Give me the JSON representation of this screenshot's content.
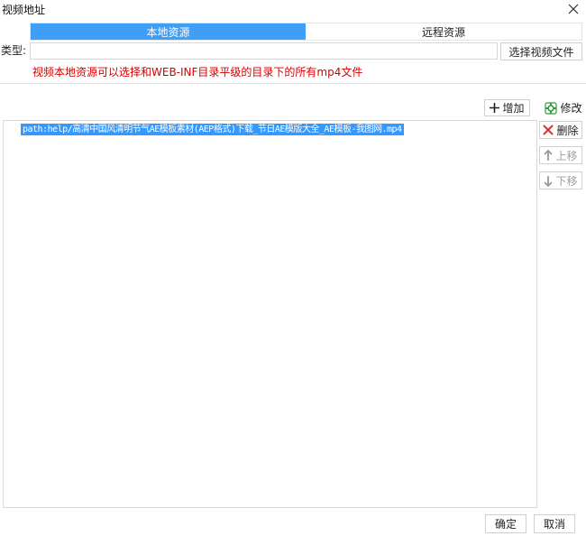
{
  "window": {
    "title": "视频地址"
  },
  "tabs": [
    {
      "label": "本地资源",
      "active": true
    },
    {
      "label": "远程资源",
      "active": false
    }
  ],
  "type_row": {
    "label": "类型:",
    "value": "",
    "choose_button": "选择视频文件"
  },
  "hint": "视频本地资源可以选择和WEB-INF目录平级的目录下的所有mp4文件",
  "toolbar": {
    "add_label": "增加",
    "edit_label": "修改"
  },
  "list": {
    "items": [
      "path:help/高清中国风清明节气AE模板素材(AEP格式)下载_节日AE模版大全_AE模板-我图网.mp4"
    ]
  },
  "side_buttons": {
    "delete_label": "删除",
    "up_label": "上移",
    "down_label": "下移"
  },
  "footer": {
    "ok_label": "确定",
    "cancel_label": "取消"
  },
  "colors": {
    "accent": "#3f9ff6",
    "hint_red": "#d40000",
    "selection": "#3399ff",
    "delete_red": "#e03030",
    "edit_green": "#2e9e3e"
  }
}
